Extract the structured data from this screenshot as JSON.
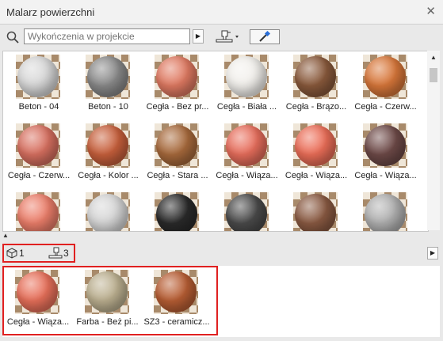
{
  "window": {
    "title": "Malarz powierzchni",
    "close_glyph": "✕"
  },
  "toolbar": {
    "search_placeholder": "Wykończenia w projekcie",
    "go_glyph": "▶"
  },
  "materials": [
    {
      "label": "Beton - 04",
      "color": "#d8d8d8"
    },
    {
      "label": "Beton - 10",
      "color": "#8a8a8a"
    },
    {
      "label": "Cegła - Bez pr...",
      "color": "#e07a62"
    },
    {
      "label": "Cegła - Biała ...",
      "color": "#f2f0ec"
    },
    {
      "label": "Cegła - Brązo...",
      "color": "#8a5a3c"
    },
    {
      "label": "Cegła - Czerw...",
      "color": "#d8773a"
    },
    {
      "label": "Cegła - Czerw...",
      "color": "#d87060"
    },
    {
      "label": "Cegła - Kolor ...",
      "color": "#c8603c"
    },
    {
      "label": "Cegła - Stara ...",
      "color": "#a86a3c"
    },
    {
      "label": "Cegła - Wiąza...",
      "color": "#e86e5c"
    },
    {
      "label": "Cegła - Wiąza...",
      "color": "#ec6e58"
    },
    {
      "label": "Cegła - Wiąza...",
      "color": "#6e4a48"
    },
    {
      "label": "",
      "color": "#ec7e6a"
    },
    {
      "label": "",
      "color": "#d6d6d6"
    },
    {
      "label": "",
      "color": "#2a2a2a"
    },
    {
      "label": "",
      "color": "#4a4a4a"
    },
    {
      "label": "",
      "color": "#8a5a42"
    },
    {
      "label": "",
      "color": "#b0b0b0"
    }
  ],
  "scrollbar": {
    "up_glyph": "▲"
  },
  "splitter": {
    "arrow_glyph": "▲"
  },
  "usage": {
    "models_count": "1",
    "surfaces_count": "3",
    "play_glyph": "▶"
  },
  "used_materials": [
    {
      "label": "Cegła - Wiąza...",
      "color": "#e8705a"
    },
    {
      "label": "Farba - Beż pi...",
      "color": "#bcb090"
    },
    {
      "label": "SZ3 - ceramicz...",
      "color": "#b85e34"
    }
  ]
}
